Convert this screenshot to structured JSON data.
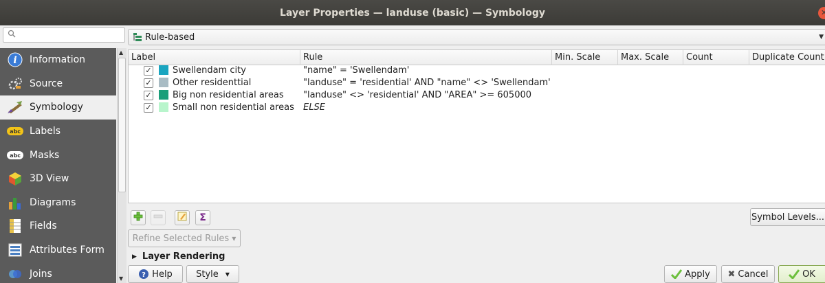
{
  "window": {
    "title": "Layer Properties — landuse (basic) — Symbology",
    "close_glyph": "✕"
  },
  "sidebar": {
    "search_placeholder": "",
    "items": [
      {
        "label": "Information",
        "icon": "info-icon",
        "active": false
      },
      {
        "label": "Source",
        "icon": "source-icon",
        "active": false
      },
      {
        "label": "Symbology",
        "icon": "symbology-icon",
        "active": true
      },
      {
        "label": "Labels",
        "icon": "labels-icon",
        "active": false
      },
      {
        "label": "Masks",
        "icon": "masks-icon",
        "active": false
      },
      {
        "label": "3D View",
        "icon": "3d-view-icon",
        "active": false
      },
      {
        "label": "Diagrams",
        "icon": "diagrams-icon",
        "active": false
      },
      {
        "label": "Fields",
        "icon": "fields-icon",
        "active": false
      },
      {
        "label": "Attributes Form",
        "icon": "attributes-form-icon",
        "active": false
      },
      {
        "label": "Joins",
        "icon": "joins-icon",
        "active": false
      }
    ]
  },
  "renderer": {
    "value": "Rule-based"
  },
  "table": {
    "columns": [
      "Label",
      "Rule",
      "Min. Scale",
      "Max. Scale",
      "Count",
      "Duplicate Count"
    ],
    "rows": [
      {
        "checked": true,
        "color": "#1aa5c0",
        "label": "Swellendam city",
        "rule": "\"name\" = 'Swellendam'",
        "else": false
      },
      {
        "checked": true,
        "color": "#a9bcc4",
        "label": "Other residenttial",
        "rule": "\"landuse\" = 'residential' AND \"name\" <> 'Swellendam'",
        "else": false
      },
      {
        "checked": true,
        "color": "#1b9e7a",
        "label": "Big non residential areas",
        "rule": "\"landuse\" <> 'residential' AND \"AREA\" >= 605000",
        "else": false
      },
      {
        "checked": true,
        "color": "#b8f5cc",
        "label": "Small non residential areas",
        "rule": "ELSE",
        "else": true
      }
    ]
  },
  "toolbar": {
    "sigma": "Σ"
  },
  "buttons": {
    "symbol_levels": "Symbol Levels...",
    "refine_rules": "Refine Selected Rules",
    "help": "Help",
    "style": "Style",
    "apply": "Apply",
    "cancel": "Cancel",
    "ok": "OK"
  },
  "section": {
    "layer_rendering": "Layer Rendering"
  }
}
